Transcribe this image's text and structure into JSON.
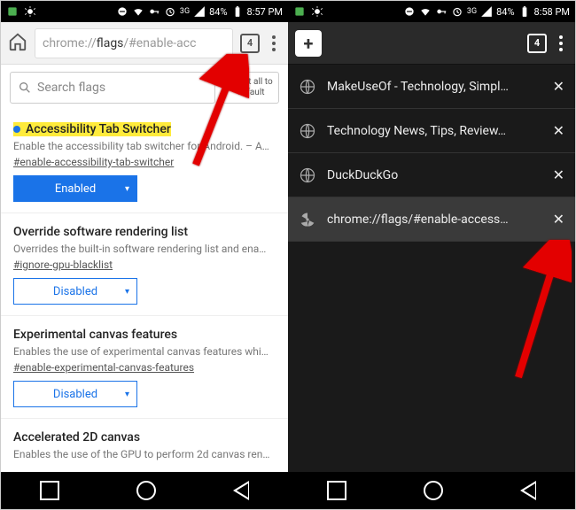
{
  "statusbar": {
    "signal": "3G",
    "battery": "84%",
    "time_left": "8:57 PM",
    "time_right": "8:58 PM"
  },
  "left": {
    "url_prefix": "chrome://",
    "url_mid": "flags",
    "url_suffix": "/#enable-acc",
    "tab_count": "4",
    "search_placeholder": "Search flags",
    "reset_label": "Reset all to default",
    "flags": [
      {
        "title": "Accessibility Tab Switcher",
        "highlight": true,
        "desc": "Enable the accessibility tab switcher for Android. – A…",
        "anchor": "#enable-accessibility-tab-switcher",
        "state": "Enabled",
        "state_kind": "enabled"
      },
      {
        "title": "Override software rendering list",
        "highlight": false,
        "desc": "Overrides the built-in software rendering list and ena…",
        "anchor": "#ignore-gpu-blacklist",
        "state": "Disabled",
        "state_kind": "disabled"
      },
      {
        "title": "Experimental canvas features",
        "highlight": false,
        "desc": "Enables the use of experimental canvas features whi…",
        "anchor": "#enable-experimental-canvas-features",
        "state": "Disabled",
        "state_kind": "disabled"
      },
      {
        "title": "Accelerated 2D canvas",
        "highlight": false,
        "desc": "Enables the use of the GPU to perform 2d canvas ren…",
        "anchor": "",
        "state": "",
        "state_kind": ""
      }
    ]
  },
  "right": {
    "tab_count": "4",
    "tabs": [
      {
        "title": "MakeUseOf - Technology, Simpl…",
        "icon": "globe",
        "active": false
      },
      {
        "title": "Technology News, Tips, Review…",
        "icon": "globe",
        "active": false
      },
      {
        "title": "DuckDuckGo",
        "icon": "globe",
        "active": false
      },
      {
        "title": "chrome://flags/#enable-access…",
        "icon": "radiation",
        "active": true
      }
    ]
  }
}
